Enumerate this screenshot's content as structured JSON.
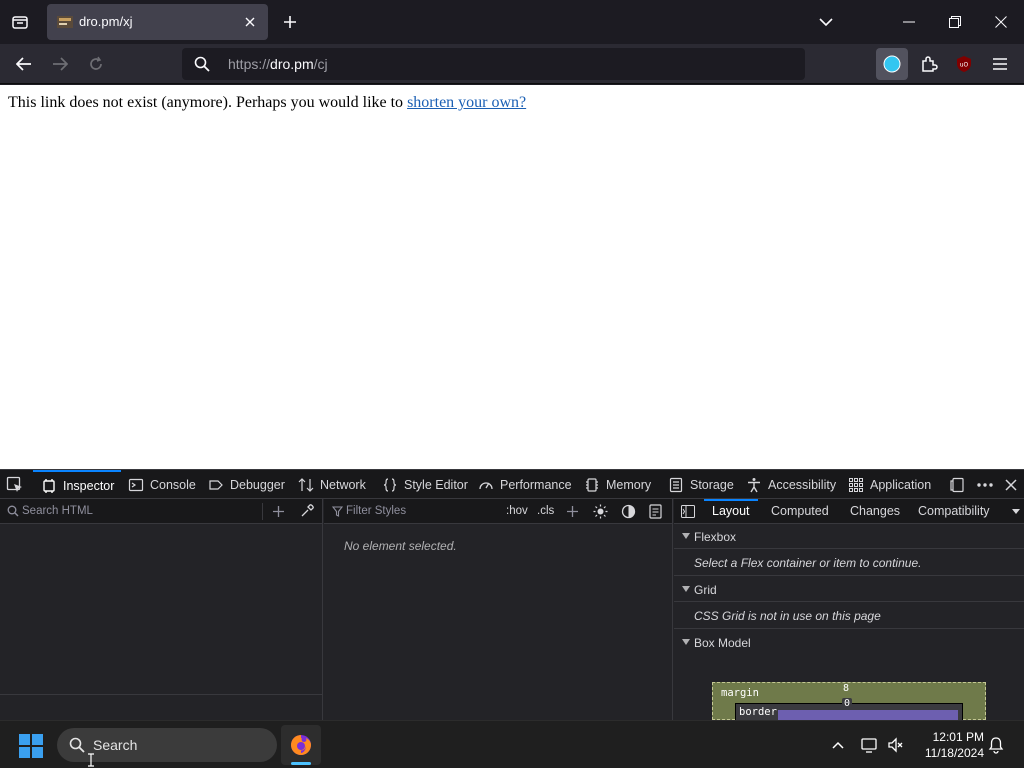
{
  "browser": {
    "tab": {
      "title": "dro.pm/xj"
    },
    "url": {
      "scheme": "https://",
      "host": "dro.pm",
      "path": "/cj"
    }
  },
  "page": {
    "text": "This link does not exist (anymore). Perhaps you would like to ",
    "link": "shorten your own?"
  },
  "devtools": {
    "tabs": [
      {
        "label": "Inspector"
      },
      {
        "label": "Console"
      },
      {
        "label": "Debugger"
      },
      {
        "label": "Network"
      },
      {
        "label": "Style Editor"
      },
      {
        "label": "Performance"
      },
      {
        "label": "Memory"
      },
      {
        "label": "Storage"
      },
      {
        "label": "Accessibility"
      },
      {
        "label": "Application"
      }
    ],
    "search_html_placeholder": "Search HTML",
    "filter_styles_placeholder": "Filter Styles",
    "hov": ":hov",
    "cls": ".cls",
    "no_element": "No element selected.",
    "layout_tabs": [
      {
        "label": "Layout"
      },
      {
        "label": "Computed"
      },
      {
        "label": "Changes"
      },
      {
        "label": "Compatibility"
      }
    ],
    "sections": {
      "flexbox": {
        "title": "Flexbox",
        "message": "Select a Flex container or item to continue."
      },
      "grid": {
        "title": "Grid",
        "message": "CSS Grid is not in use on this page"
      },
      "box_model": {
        "title": "Box Model"
      }
    },
    "box_model": {
      "margin_label": "margin",
      "margin_value": "8",
      "border_label": "border",
      "border_value": "0"
    }
  },
  "taskbar": {
    "search_label": "Search",
    "time": "12:01 PM",
    "date": "11/18/2024"
  },
  "colors": {
    "accent": "#0a84ff",
    "link": "#1a5fb4",
    "margin_box": "#6f7a4a"
  }
}
